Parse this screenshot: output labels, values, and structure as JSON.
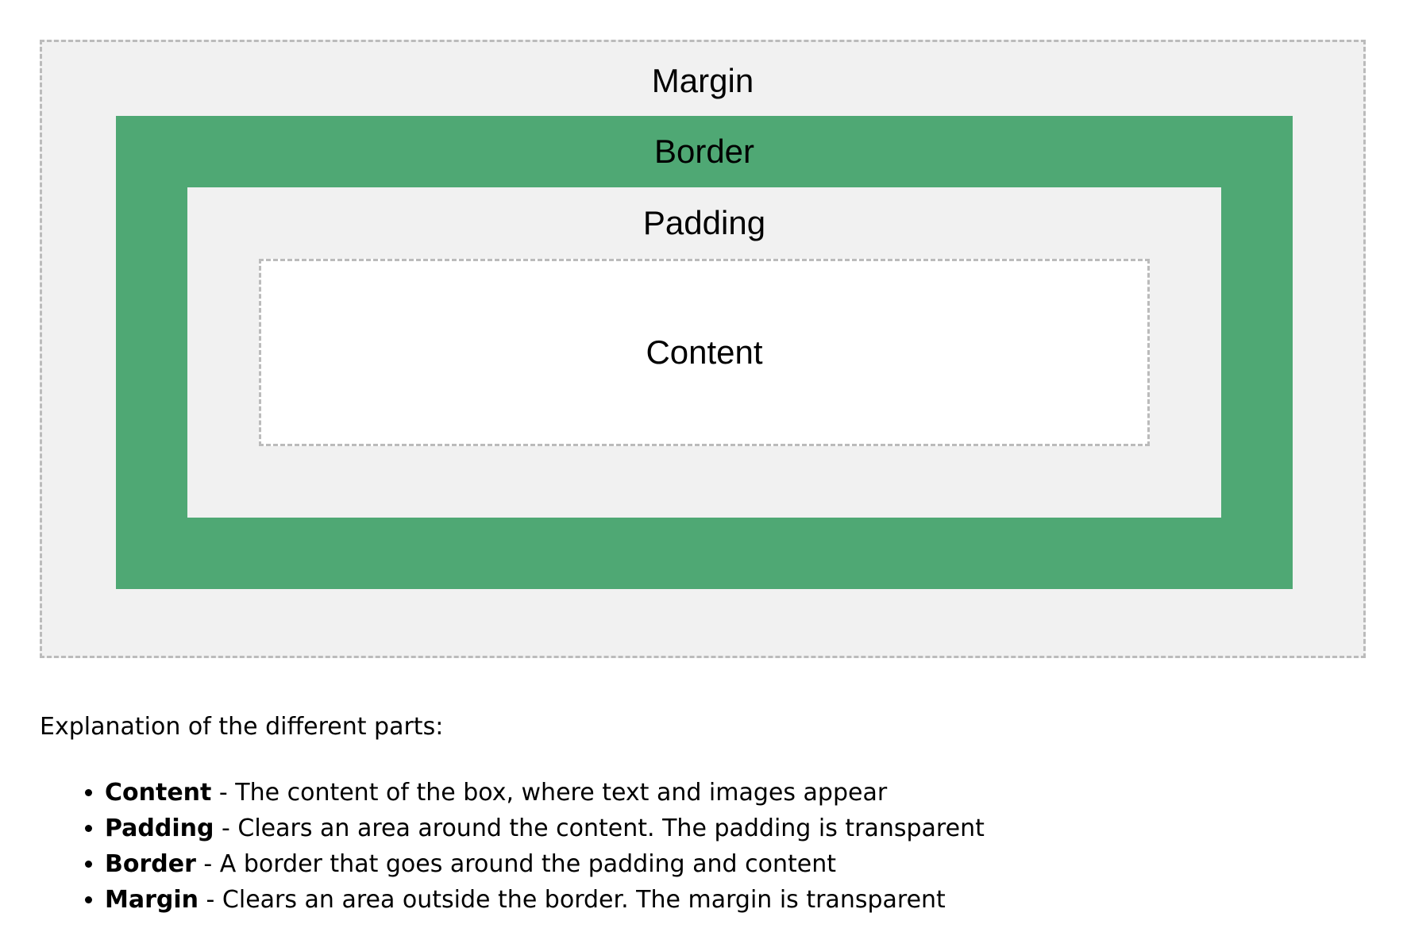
{
  "diagram": {
    "margin_label": "Margin",
    "border_label": "Border",
    "padding_label": "Padding",
    "content_label": "Content",
    "colors": {
      "margin": "#f1f1f1",
      "border": "#4fa874",
      "padding": "#f1f1f1",
      "content": "#ffffff",
      "dashed_outline": "#bbbbbb"
    }
  },
  "explanation": {
    "heading": "Explanation of the different parts:",
    "items": [
      {
        "term": "Content",
        "description": " - The content of the box, where text and images appear"
      },
      {
        "term": "Padding",
        "description": " - Clears an area around the content. The padding is transparent"
      },
      {
        "term": "Border",
        "description": " - A border that goes around the padding and content"
      },
      {
        "term": "Margin",
        "description": " - Clears an area outside the border. The margin is transparent"
      }
    ]
  }
}
